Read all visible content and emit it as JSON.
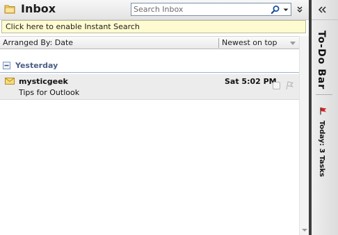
{
  "header": {
    "title": "Inbox",
    "search_placeholder": "Search Inbox"
  },
  "info_bar": {
    "text": "Click here to enable Instant Search"
  },
  "arrange_bar": {
    "arranged_by": "Arranged By: Date",
    "sort_order": "Newest on top"
  },
  "groups": [
    {
      "label": "Yesterday",
      "messages": [
        {
          "sender": "mysticgeek",
          "time": "Sat 5:02 PM",
          "subject": "Tips for Outlook"
        }
      ]
    }
  ],
  "todo_bar": {
    "title": "To-Do Bar",
    "tasks_label": "Today: 3 Tasks"
  },
  "colors": {
    "info_bar_bg": "#fffbd1",
    "group_label": "#4a5f83",
    "selected_row": "#ececec",
    "task_flag": "#d42020"
  },
  "icons": {
    "folder": "folder-icon",
    "search": "search-icon",
    "envelope": "envelope-icon",
    "flag": "flag-icon"
  }
}
